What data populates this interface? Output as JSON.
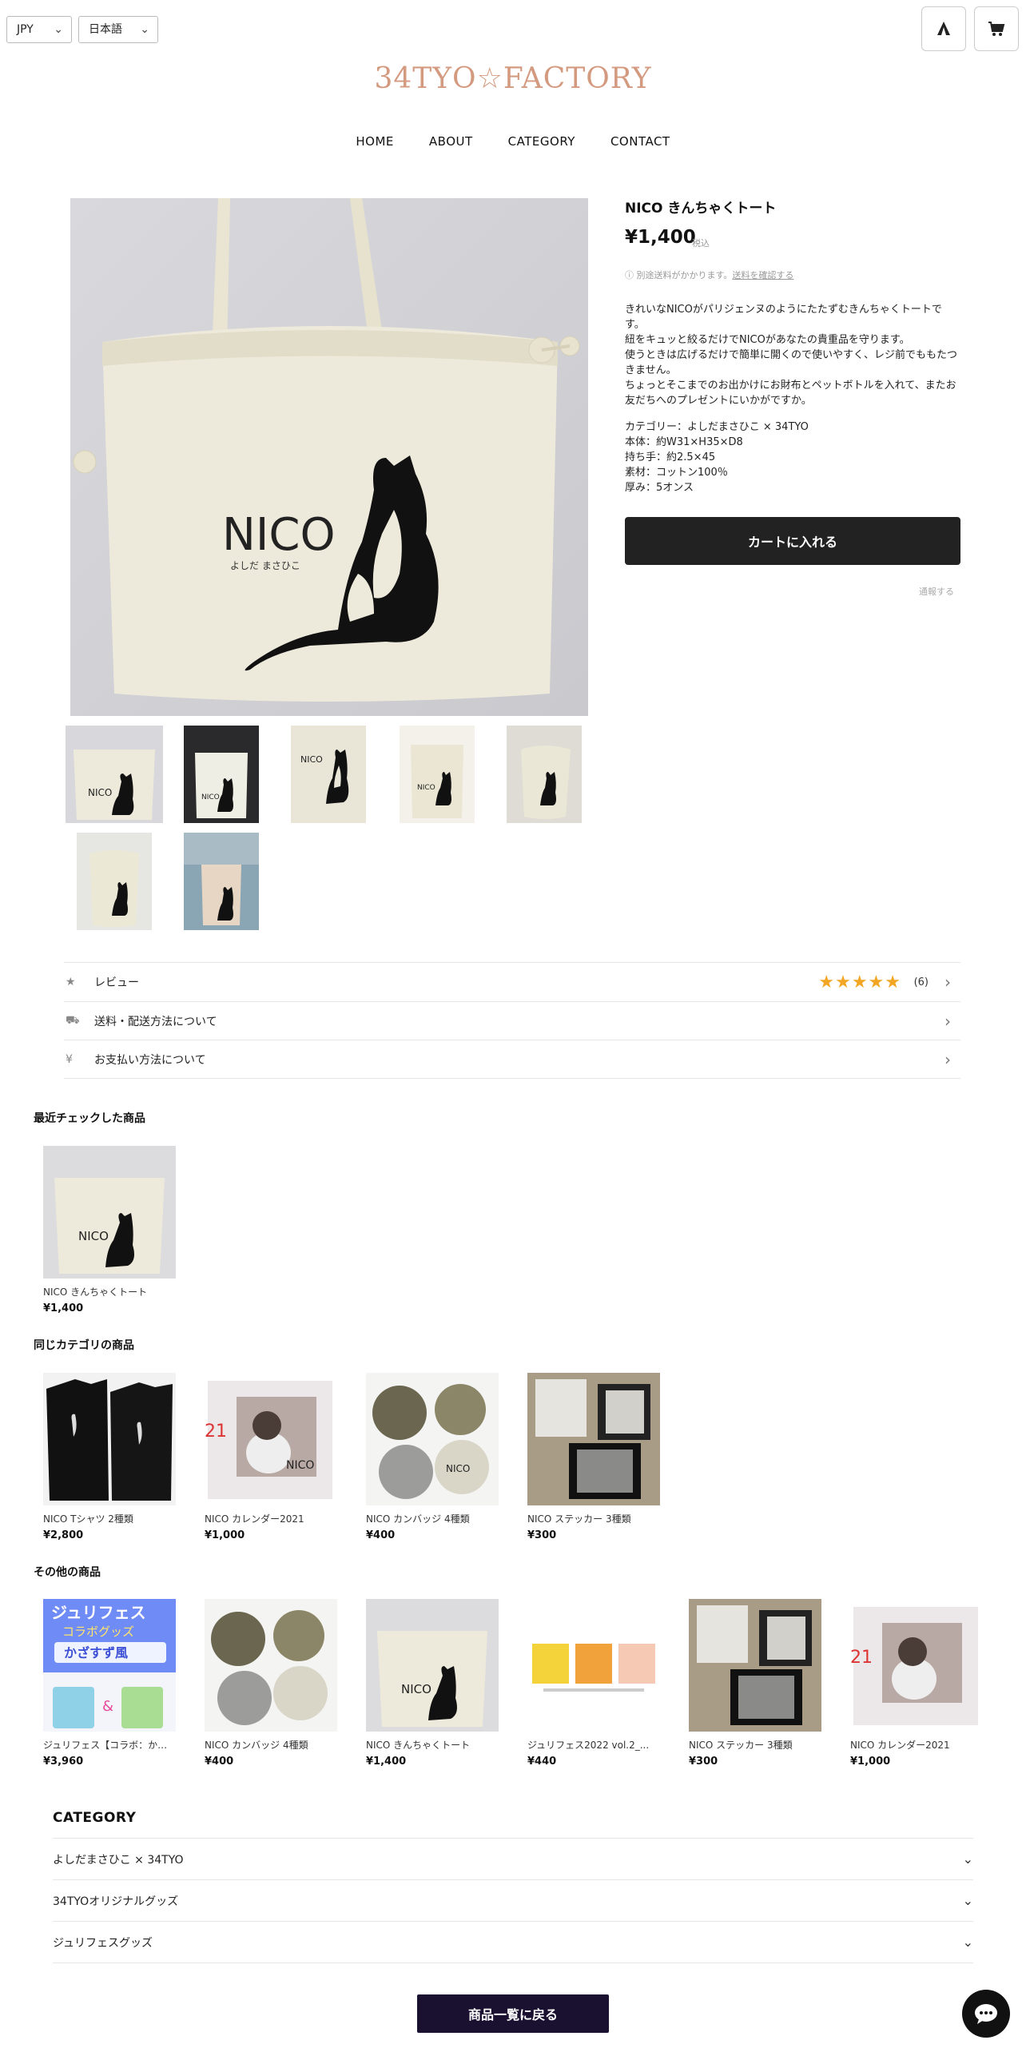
{
  "header": {
    "currency": "JPY",
    "language": "日本語",
    "logo": "34TYO☆FACTORY",
    "nav": [
      "HOME",
      "ABOUT",
      "CATEGORY",
      "CONTACT"
    ]
  },
  "product": {
    "title": "NICO きんちゃくトート",
    "price": "¥1,400",
    "tax_label": "税込",
    "shipping_note": "別途送料がかかります。",
    "shipping_link": "送料を確認する",
    "description": [
      "きれいなNICOがパリジェンヌのようにたたずむきんちゃくトートです。",
      "紐をキュッと絞るだけでNICOがあなたの貴重品を守ります。",
      "使うときは広げるだけで簡単に開くので使いやすく、レジ前でももたつきません。",
      "ちょっとそこまでのお出かけにお財布とペットボトルを入れて、またお友だちへのプレゼントにいかがですか。"
    ],
    "specs": [
      "カテゴリー：よしだまさひこ × 34TYO",
      "本体：約W31×H35×D8",
      "持ち手：約2.5×45",
      "素材：コットン100％",
      "厚み：5オンス"
    ],
    "cart_button": "カートに入れる",
    "report_link": "通報する",
    "main_image_text": "NICO",
    "main_image_subtext": "よしだ まさひこ"
  },
  "info_rows": {
    "review_label": "レビュー",
    "review_stars": "★★★★★",
    "review_count": "(6)",
    "shipping_label": "送料・配送方法について",
    "payment_label": "お支払い方法について"
  },
  "recent": {
    "heading": "最近チェックした商品",
    "items": [
      {
        "name": "NICO きんちゃくトート",
        "price": "¥1,400"
      }
    ]
  },
  "same_category": {
    "heading": "同じカテゴリの商品",
    "items": [
      {
        "name": "NICO Tシャツ 2種類",
        "price": "¥2,800"
      },
      {
        "name": "NICO カレンダー2021",
        "price": "¥1,000"
      },
      {
        "name": "NICO カンバッジ 4種類",
        "price": "¥400"
      },
      {
        "name": "NICO ステッカー 3種類",
        "price": "¥300"
      }
    ]
  },
  "other": {
    "heading": "その他の商品",
    "items": [
      {
        "name": "ジュリフェス【コラボ：かざすず風】",
        "price": "¥3,960"
      },
      {
        "name": "NICO カンバッジ 4種類",
        "price": "¥400"
      },
      {
        "name": "NICO きんちゃくトート",
        "price": "¥1,400"
      },
      {
        "name": "ジュリフェス2022 vol.2_...",
        "price": "¥440"
      },
      {
        "name": "NICO ステッカー 3種類",
        "price": "¥300"
      },
      {
        "name": "NICO カレンダー2021",
        "price": "¥1,000"
      }
    ],
    "julifes_banner_line1": "ジュリフェス",
    "julifes_banner_line2": "コラボグッズ",
    "julifes_banner_line3": "かざすず風"
  },
  "category": {
    "heading": "CATEGORY",
    "items": [
      "よしだまさひこ × 34TYO",
      "34TYOオリジナルグッズ",
      "ジュリフェスグッズ"
    ]
  },
  "back_button": "商品一覧に戻る",
  "colors": {
    "logo": "#d39a7f",
    "star": "#f3a623",
    "cart_button": "#222222",
    "back_button": "#1a1030"
  }
}
